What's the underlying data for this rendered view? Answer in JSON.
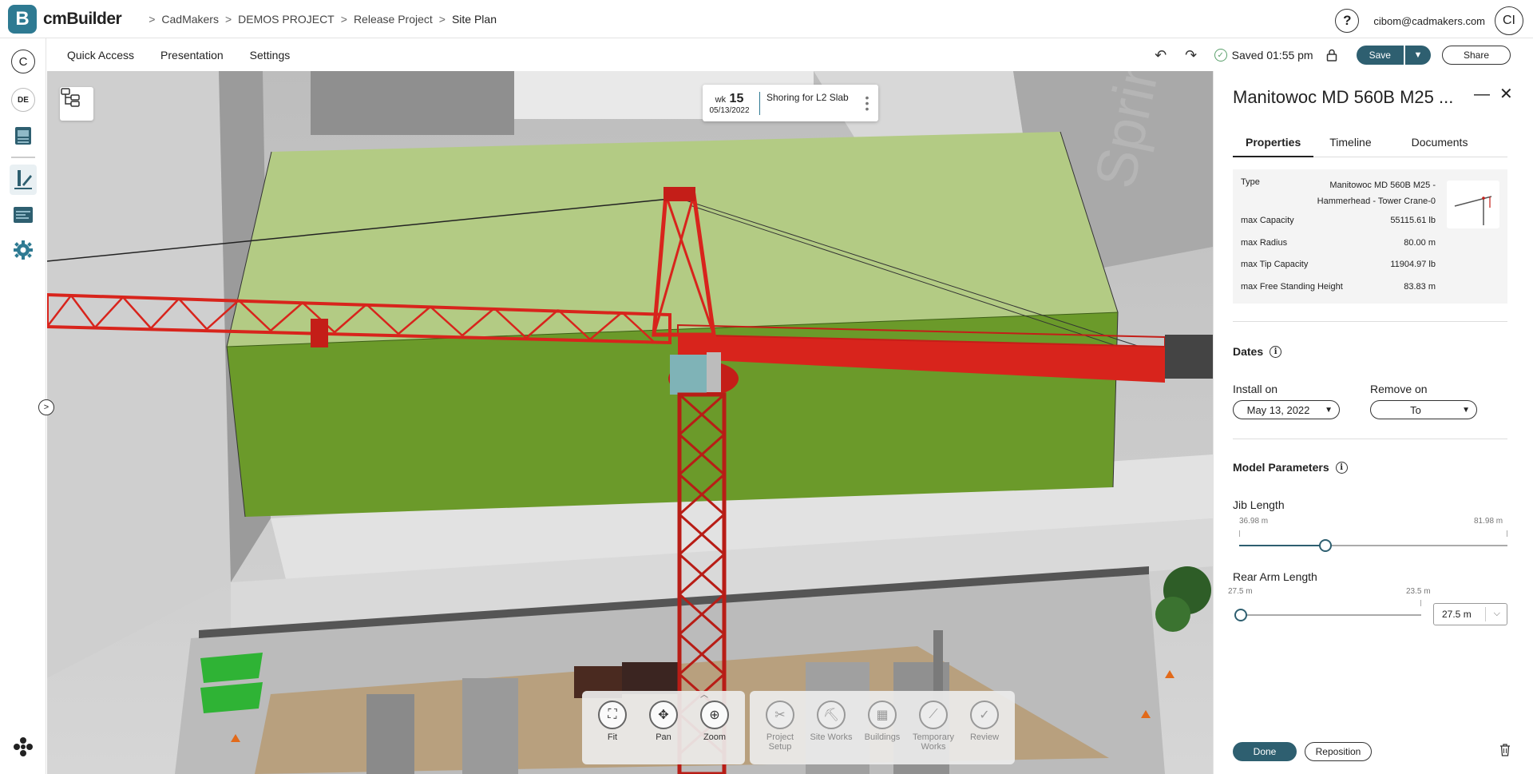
{
  "app": {
    "logo_letter": "B",
    "name": "cmBuilder"
  },
  "breadcrumb": [
    "CadMakers",
    "DEMOS PROJECT",
    "Release Project",
    "Site Plan"
  ],
  "user": {
    "help": "?",
    "email": "cibom@cadmakers.com",
    "initials": "CI"
  },
  "rail": {
    "company": "C",
    "user": "DE"
  },
  "menu": {
    "items": [
      "Quick Access",
      "Presentation",
      "Settings"
    ]
  },
  "toolbar": {
    "saved": "Saved 01:55 pm",
    "save": "Save",
    "share": "Share"
  },
  "schedule": {
    "wk_label": "wk",
    "wk_number": "15",
    "date": "05/13/2022",
    "task": "Shoring for L2 Slab"
  },
  "bottom_tools": {
    "nav": [
      {
        "label": "Fit"
      },
      {
        "label": "Pan"
      },
      {
        "label": "Zoom"
      }
    ],
    "modes": [
      {
        "label": "Project Setup"
      },
      {
        "label": "Site Works"
      },
      {
        "label": "Buildings"
      },
      {
        "label": "Temporary Works"
      },
      {
        "label": "Review"
      }
    ]
  },
  "panel": {
    "title": "Manitowoc MD 560B M25 ...",
    "tabs": [
      "Properties",
      "Timeline",
      "Documents"
    ],
    "properties": [
      {
        "label": "Type",
        "value": "Manitowoc MD 560B M25 - Hammerhead - Tower Crane-0"
      },
      {
        "label": "max Capacity",
        "value": "55115.61 lb"
      },
      {
        "label": "max Radius",
        "value": "80.00 m"
      },
      {
        "label": "max Tip Capacity",
        "value": "11904.97 lb"
      },
      {
        "label": "max Free Standing Height",
        "value": "83.83 m"
      }
    ],
    "dates": {
      "title": "Dates",
      "install_label": "Install on",
      "install_value": "May 13, 2022",
      "remove_label": "Remove on",
      "remove_value": "To"
    },
    "model": {
      "title": "Model Parameters",
      "jib": {
        "label": "Jib Length",
        "min": "36.98 m",
        "max": "81.98 m",
        "fraction": 0.32
      },
      "rear": {
        "label": "Rear Arm Length",
        "min": "27.5 m",
        "max": "23.5 m",
        "value": "27.5 m",
        "fraction": 0.0
      }
    },
    "done": "Done",
    "reposition": "Reposition"
  },
  "colors": {
    "accent": "#2e5f70",
    "building_top": "#b3cb84",
    "building_side": "#6b9a2a",
    "crane": "#d8241c"
  }
}
